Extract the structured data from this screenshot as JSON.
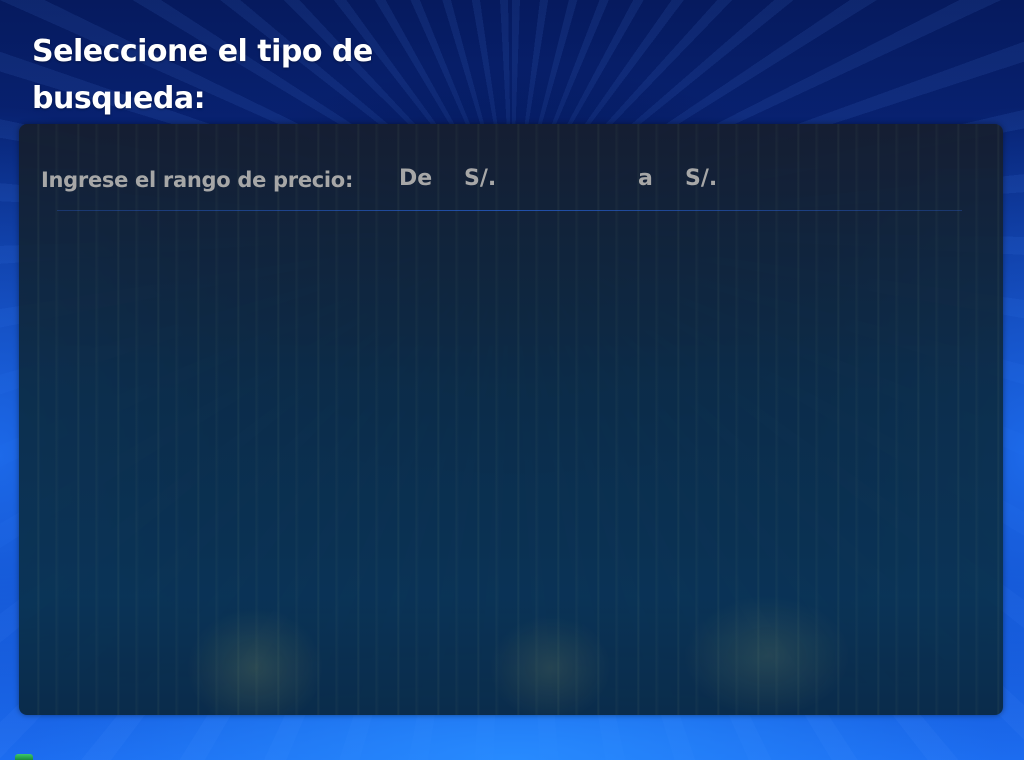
{
  "title": "Seleccione el tipo de busqueda:",
  "price_filter": {
    "label": "Ingrese el rango de precio:",
    "from_label": "De",
    "to_label": "a",
    "currency": "S/.",
    "from_value": "",
    "to_value": ""
  },
  "colors": {
    "label_text": "#a7a7a7",
    "title_text": "#ffffff",
    "divider": "#2864dc"
  }
}
